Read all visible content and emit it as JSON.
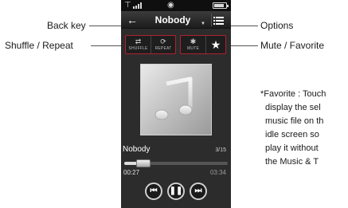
{
  "phone": {
    "title": "Nobody",
    "controls": {
      "shuffle_label": "SHUFFLE",
      "repeat_label": "REPEAT",
      "mute_label": "MUTE"
    },
    "track": {
      "name": "Nobody",
      "count": "3/15",
      "progress": 0.13,
      "elapsed": "00:27",
      "total": "03:34"
    }
  },
  "callouts": {
    "back_key": "Back key",
    "shuffle_repeat": "Shuffle / Repeat",
    "options": "Options",
    "mute_favorite": "Mute / Favorite"
  },
  "favorite_note": {
    "line1": "*Favorite : Touch",
    "line2": "display the sel",
    "line3": "music file on th",
    "line4": "idle screen so",
    "line5": "play it without",
    "line6": "the Music & T"
  },
  "colors": {
    "accent_border": "#b02030",
    "screen_bg": "#2c2c2c"
  }
}
